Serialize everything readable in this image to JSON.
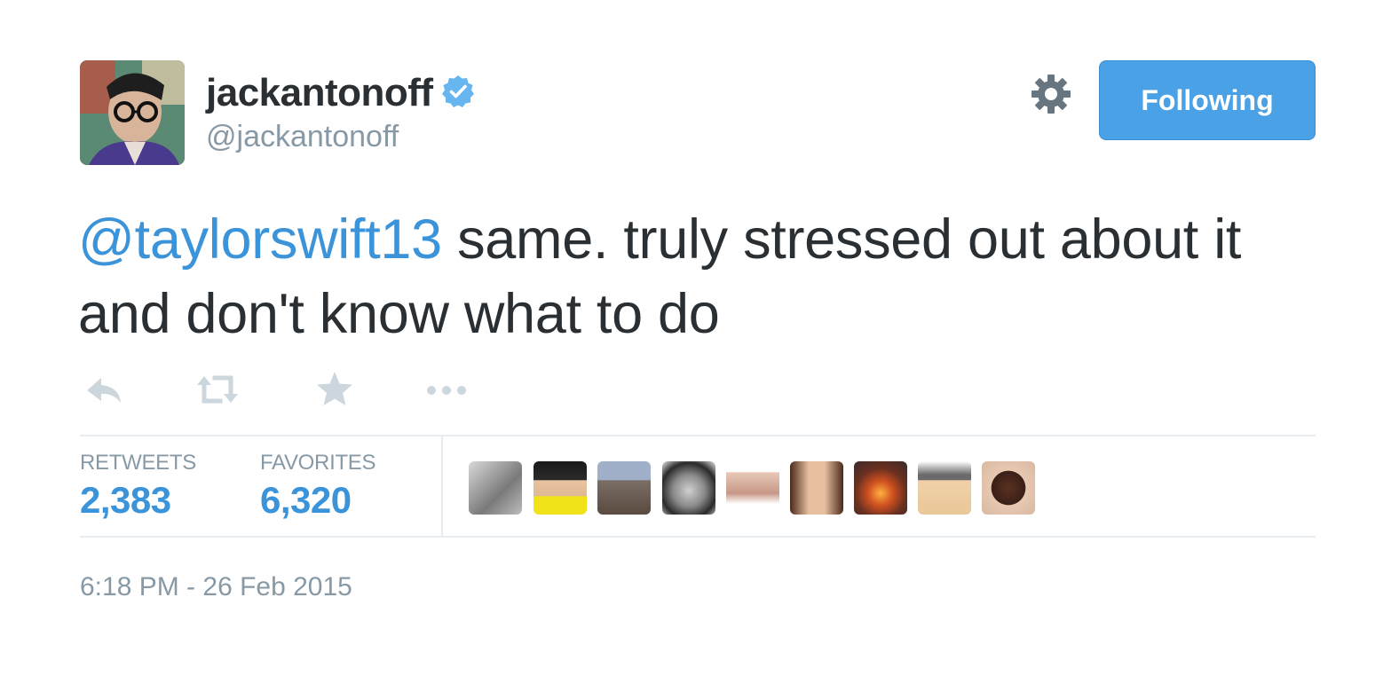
{
  "user": {
    "full_name": "jackantonoff",
    "handle": "@jackantonoff",
    "verified_icon": "verified-badge-icon"
  },
  "header": {
    "settings_icon": "gear-icon",
    "follow_button_label": "Following",
    "follow_button_color": "#4aa1e5"
  },
  "tweet": {
    "mention": "@taylorswift13",
    "text_rest": " same. truly stressed out about it and don't know what to do"
  },
  "actions": [
    {
      "name": "reply-icon"
    },
    {
      "name": "retweet-icon"
    },
    {
      "name": "favorite-star-icon"
    },
    {
      "name": "more-ellipsis-icon"
    }
  ],
  "stats": {
    "retweets_label": "RETWEETS",
    "retweets_count": "2,383",
    "favorites_label": "FAVORITES",
    "favorites_count": "6,320"
  },
  "favoriters_count_shown": 9,
  "timestamp": "6:18 PM - 26 Feb 2015",
  "colors": {
    "link_blue": "#3b94d9",
    "muted_gray": "#8899a6",
    "text_dark": "#292f33",
    "divider": "#e6ecf0"
  }
}
